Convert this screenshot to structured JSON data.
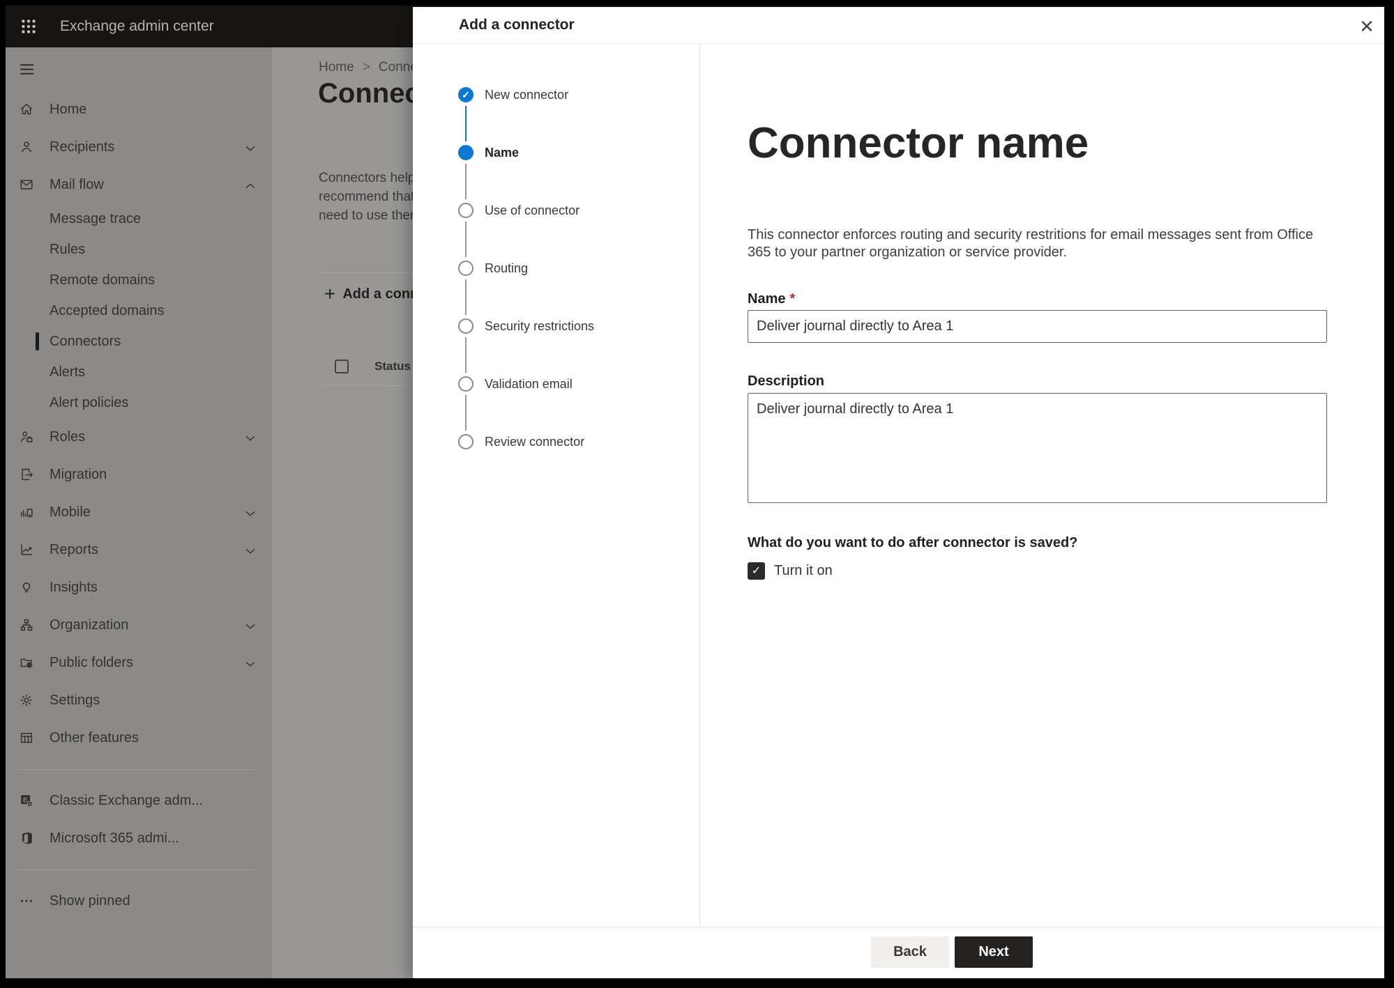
{
  "colors": {
    "accent_blue": "#0f77d0",
    "next_button_bg": "#252321",
    "required_red": "#c02b2c",
    "topbar_bg": "#161514"
  },
  "topbar": {
    "title": "Exchange admin center"
  },
  "sidebar": {
    "items": [
      {
        "label": "Home",
        "icon": "home",
        "type": "main"
      },
      {
        "label": "Recipients",
        "icon": "person",
        "type": "main",
        "chevron": "down"
      },
      {
        "label": "Mail flow",
        "icon": "mail",
        "type": "main",
        "chevron": "up"
      },
      {
        "label": "Message trace",
        "type": "sub"
      },
      {
        "label": "Rules",
        "type": "sub"
      },
      {
        "label": "Remote domains",
        "type": "sub"
      },
      {
        "label": "Accepted domains",
        "type": "sub"
      },
      {
        "label": "Connectors",
        "type": "sub",
        "selected": true
      },
      {
        "label": "Alerts",
        "type": "sub"
      },
      {
        "label": "Alert policies",
        "type": "sub"
      },
      {
        "label": "Roles",
        "icon": "roles",
        "type": "main",
        "chevron": "down"
      },
      {
        "label": "Migration",
        "icon": "migration",
        "type": "main"
      },
      {
        "label": "Mobile",
        "icon": "mobile",
        "type": "main",
        "chevron": "down"
      },
      {
        "label": "Reports",
        "icon": "reports",
        "type": "main",
        "chevron": "down"
      },
      {
        "label": "Insights",
        "icon": "insights",
        "type": "main"
      },
      {
        "label": "Organization",
        "icon": "organization",
        "type": "main",
        "chevron": "down"
      },
      {
        "label": "Public folders",
        "icon": "public-folders",
        "type": "main",
        "chevron": "down"
      },
      {
        "label": "Settings",
        "icon": "settings",
        "type": "main"
      },
      {
        "label": "Other features",
        "icon": "other-features",
        "type": "main"
      },
      {
        "type": "divider"
      },
      {
        "label": "Classic Exchange adm...",
        "icon": "exchange",
        "type": "main"
      },
      {
        "label": "Microsoft 365 admi...",
        "icon": "m365",
        "type": "main"
      },
      {
        "type": "divider"
      },
      {
        "label": "Show pinned",
        "icon": "ellipsis",
        "type": "main"
      }
    ]
  },
  "page": {
    "breadcrumb": {
      "home": "Home",
      "current": "Conne"
    },
    "heading": "Connect",
    "intro_lines": [
      "Connectors help",
      "recommend that",
      "need to use ther"
    ],
    "add_button_label": "Add a conn",
    "table": {
      "status_header": "Status"
    }
  },
  "panel": {
    "title": "Add a connector",
    "steps": [
      {
        "label": "New connector",
        "state": "done"
      },
      {
        "label": "Name",
        "state": "current"
      },
      {
        "label": "Use of connector",
        "state": "todo"
      },
      {
        "label": "Routing",
        "state": "todo"
      },
      {
        "label": "Security restrictions",
        "state": "todo"
      },
      {
        "label": "Validation email",
        "state": "todo"
      },
      {
        "label": "Review connector",
        "state": "todo"
      }
    ],
    "content": {
      "heading": "Connector name",
      "description": "This connector enforces routing and security restritions for email messages sent from Office 365 to your partner organization or service provider.",
      "name_label": "Name",
      "required_marker": "*",
      "name_value": "Deliver journal directly to Area 1",
      "description_label": "Description",
      "description_value": "Deliver journal directly to Area 1",
      "question": "What do you want to do after connector is saved?",
      "turn_on_label": "Turn it on",
      "turn_on_checked": true
    },
    "footer": {
      "back": "Back",
      "next": "Next"
    }
  },
  "icons": {
    "check": "✓",
    "close": "✕",
    "plus": "+",
    "breadcrumb_separator": ">"
  }
}
